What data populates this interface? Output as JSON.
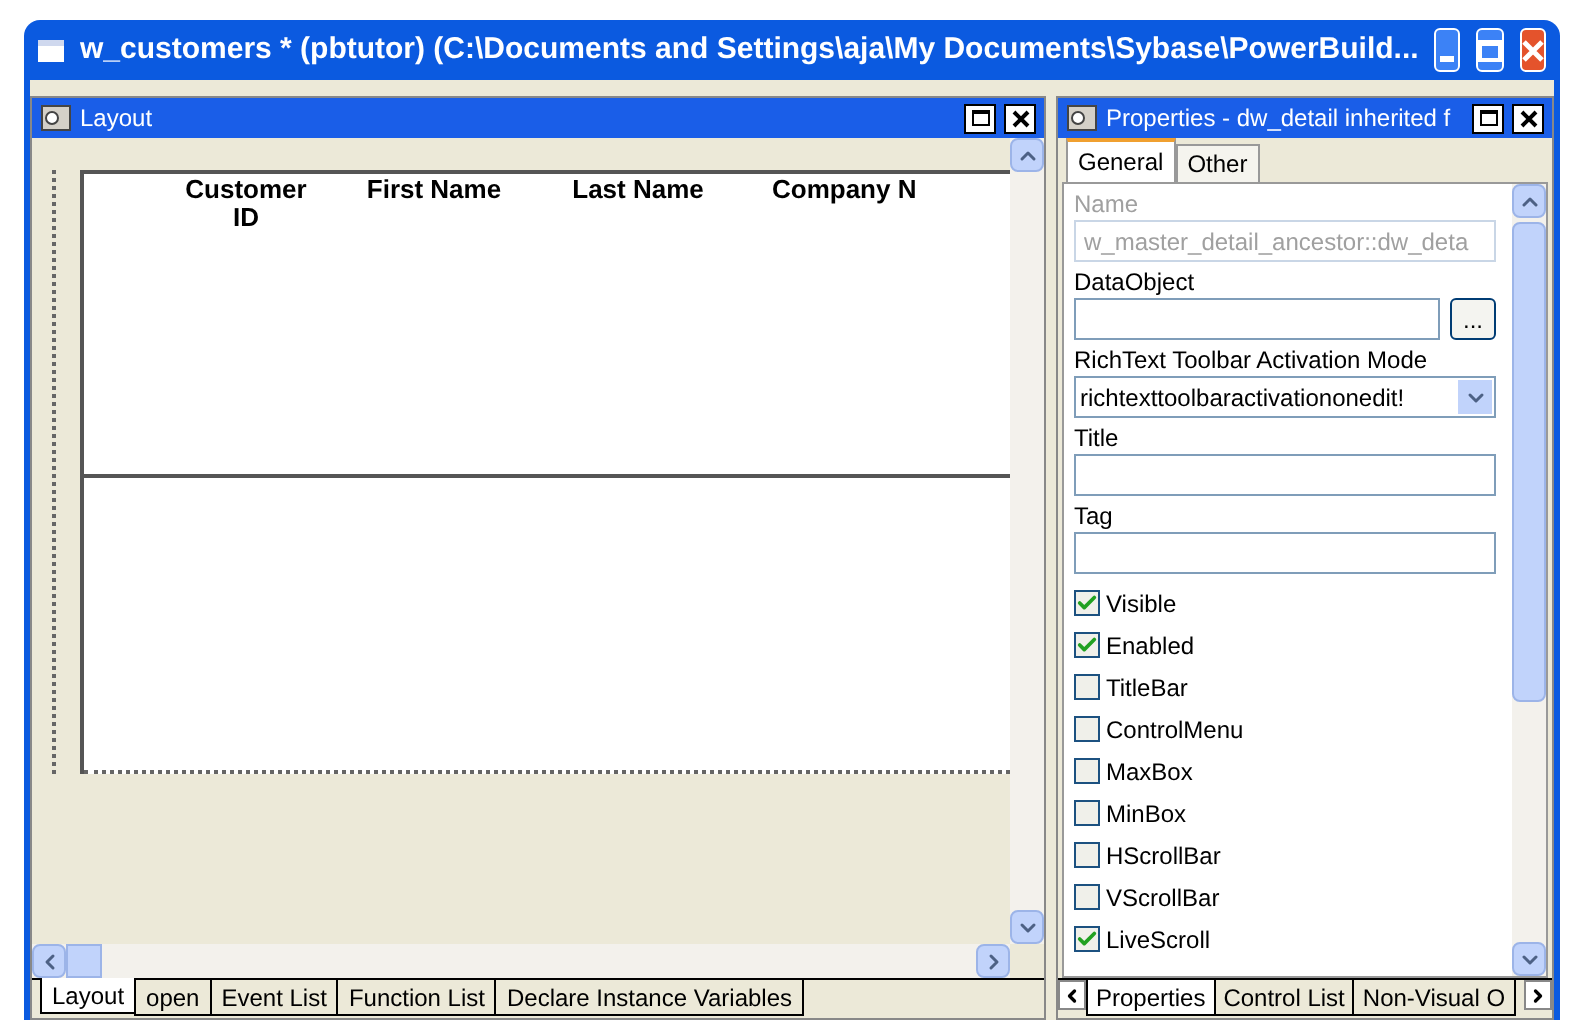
{
  "window": {
    "title": "w_customers * (pbtutor) (C:\\Documents and Settings\\aja\\My Documents\\Sybase\\PowerBuild..."
  },
  "layout_panel": {
    "title": "Layout",
    "columns": [
      "Customer ID",
      "First Name",
      "Last Name",
      "Company N"
    ],
    "tabs": [
      {
        "label": "Layout",
        "selected": true
      },
      {
        "label": "open",
        "selected": false
      },
      {
        "label": "Event List",
        "selected": false
      },
      {
        "label": "Function List",
        "selected": false
      },
      {
        "label": "Declare Instance Variables",
        "selected": false
      }
    ]
  },
  "properties_panel": {
    "title": "Properties -  dw_detail  inherited  f",
    "tabs": [
      {
        "label": "General",
        "selected": true
      },
      {
        "label": "Other",
        "selected": false
      }
    ],
    "fields": [
      {
        "kind": "text",
        "label": "Name",
        "value": "w_master_detail_ancestor::dw_deta",
        "disabled": true
      },
      {
        "kind": "browse",
        "label": "DataObject",
        "button": "..."
      },
      {
        "kind": "dropdown",
        "label": "RichText Toolbar Activation Mode",
        "value": "richtexttoolbaractivationonedit!"
      },
      {
        "kind": "text",
        "label": "Title"
      },
      {
        "kind": "text",
        "label": "Tag"
      }
    ],
    "checkboxes": [
      {
        "label": "Visible",
        "checked": true
      },
      {
        "label": "Enabled",
        "checked": true
      },
      {
        "label": "TitleBar",
        "checked": false
      },
      {
        "label": "ControlMenu",
        "checked": false
      },
      {
        "label": "MaxBox",
        "checked": false
      },
      {
        "label": "MinBox",
        "checked": false
      },
      {
        "label": "HScrollBar",
        "checked": false
      },
      {
        "label": "VScrollBar",
        "checked": false
      },
      {
        "label": "LiveScroll",
        "checked": true
      }
    ],
    "bottom_tabs": [
      {
        "label": "Properties",
        "selected": true
      },
      {
        "label": "Control List",
        "selected": false
      },
      {
        "label": "Non-Visual O",
        "selected": false
      }
    ]
  }
}
